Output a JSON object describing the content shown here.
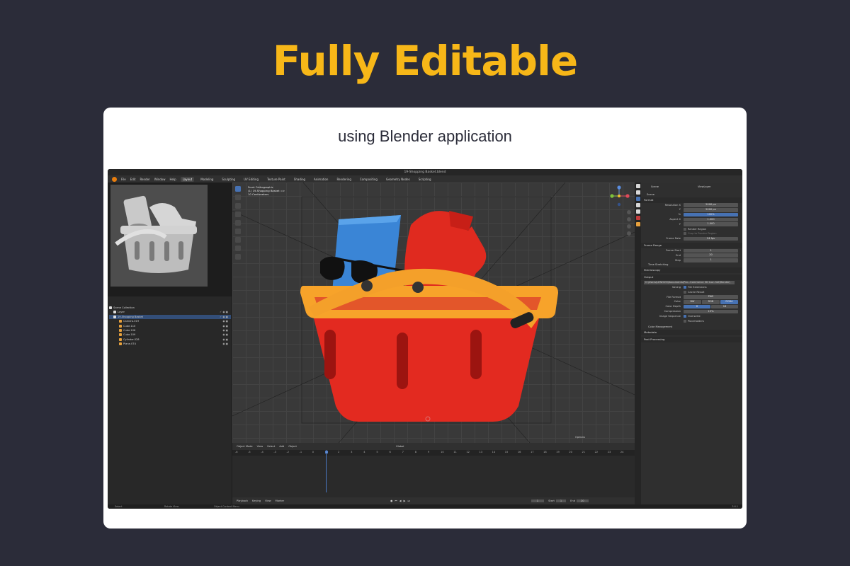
{
  "headline": "Fully Editable",
  "subtitle": "using Blender application",
  "colors": {
    "headline": "#f7b718",
    "background": "#2b2c39",
    "card": "#ffffff",
    "blender_accent": "#4772b3"
  },
  "window": {
    "title": "19-Shopping Basket.blend"
  },
  "menus": [
    "File",
    "Edit",
    "Render",
    "Window",
    "Help"
  ],
  "workspaces": [
    "Layout",
    "Modeling",
    "Sculpting",
    "UV Editing",
    "Texture Paint",
    "Shading",
    "Animation",
    "Rendering",
    "Compositing",
    "Geometry Nodes",
    "Scripting"
  ],
  "outliner": {
    "rows": [
      {
        "label": "Scene Collection"
      },
      {
        "label": "Layer"
      },
      {
        "label": "19-Shopping Basket"
      },
      {
        "label": "Camera.019"
      },
      {
        "label": "Cube.110"
      },
      {
        "label": "Cube.106"
      },
      {
        "label": "Cube.109"
      },
      {
        "label": "Cylinder.028"
      },
      {
        "label": "Plane.074"
      }
    ]
  },
  "viewport": {
    "view_name": "Front Orthographic",
    "collection": "(1) 19-Shopping Basket =>",
    "units": "10 Centimeters",
    "overlay_label": "Options"
  },
  "timeline_header": [
    "Object Mode",
    "View",
    "Select",
    "Add",
    "Object",
    "Global"
  ],
  "timeline": {
    "ticks": [
      "-6",
      "-5",
      "-4",
      "-3",
      "-2",
      "-1",
      "0",
      "1",
      "2",
      "3",
      "4",
      "5",
      "6",
      "7",
      "8",
      "9",
      "10",
      "11",
      "12",
      "13",
      "14",
      "15",
      "16",
      "17",
      "18",
      "19",
      "20",
      "21",
      "22",
      "23",
      "24"
    ],
    "current_frame": "1"
  },
  "playback": {
    "menus": [
      "Playback",
      "Keying",
      "View",
      "Marker"
    ],
    "frame": "1",
    "start_label": "Start",
    "start": "1",
    "end_label": "End",
    "end": "20"
  },
  "status": {
    "select": "Select",
    "rotate": "Rotate View",
    "context": "Object Context Menu",
    "version": "3.6.1"
  },
  "properties": {
    "scene": "Scene",
    "view_layer": "ViewLayer",
    "scene_label": "Scene",
    "format_section": "Format",
    "resolution_x_label": "Resolution X",
    "resolution_x": "2000 px",
    "resolution_y_label": "Y",
    "resolution_y": "2000 px",
    "percent_label": "%",
    "percent": "100%",
    "aspect_x_label": "Aspect X",
    "aspect_x": "1.000",
    "aspect_y_label": "Y",
    "aspect_y": "1.000",
    "render_region": "Render Region",
    "crop_region": "Crop to Render Region",
    "frame_rate_label": "Frame Rate",
    "frame_rate": "24 fps",
    "frame_range_section": "Frame Range",
    "frame_start_label": "Frame Start",
    "frame_start": "1",
    "end_label": "End",
    "end": "20",
    "step_label": "Step",
    "step": "1",
    "time_stretching": "Time Stretching",
    "stereoscopy": "Stereoscopy",
    "output_section": "Output",
    "output_path": "C:\\Users\\LENOVO\\Documents\\Pro...Commerce 3D Icon Set\\Render\\",
    "saving_label": "Saving",
    "file_extensions": "File Extensions",
    "cache_result": "Cache Result",
    "file_format_label": "File Format",
    "file_format": "PNG",
    "color_label": "Color",
    "color_options": [
      "BW",
      "RGB",
      "RGBA"
    ],
    "color_depth_label": "Color Depth",
    "color_depth_options": [
      "8",
      "16"
    ],
    "compression_label": "Compression",
    "compression": "15%",
    "image_sequence_label": "Image Sequence",
    "overwrite": "Overwrite",
    "placeholders": "Placeholders",
    "color_management": "Color Management",
    "metadata": "Metadata",
    "post_processing": "Post Processing"
  }
}
